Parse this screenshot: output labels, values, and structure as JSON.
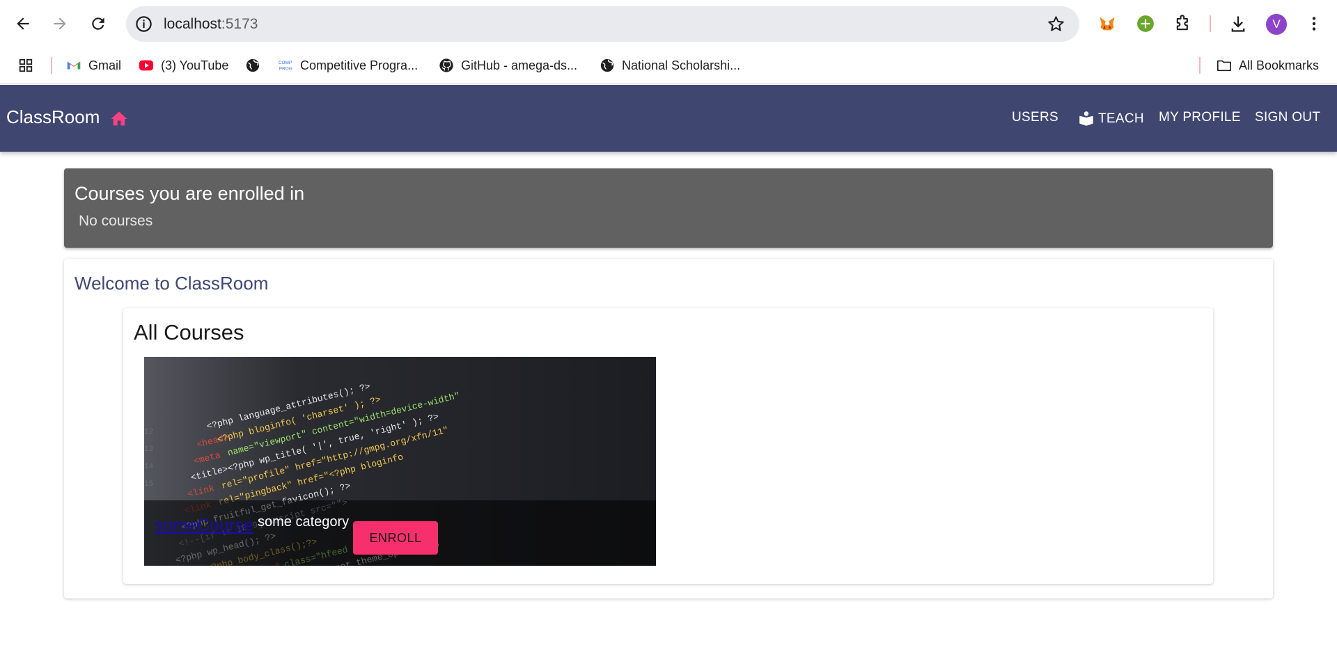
{
  "browser": {
    "url_host": "localhost",
    "url_port": ":5173",
    "avatar_letter": "V",
    "bookmarks": [
      {
        "label": "Gmail"
      },
      {
        "label": "(3) YouTube"
      },
      {
        "label": ""
      },
      {
        "label": "Competitive Progra..."
      },
      {
        "label": "GitHub - amega-ds..."
      },
      {
        "label": "National Scholarshi..."
      }
    ],
    "all_bookmarks_label": "All Bookmarks"
  },
  "appbar": {
    "brand": "ClassRoom",
    "links": {
      "users": "USERS",
      "teach": "TEACH",
      "profile": "MY PROFILE",
      "signout": "SIGN OUT"
    },
    "colors": {
      "bar": "#3f4771",
      "home_icon": "#ff4081"
    }
  },
  "enrolled": {
    "title": "Courses you are enrolled in",
    "empty_text": "No courses"
  },
  "welcome": {
    "title": "Welcome to ClassRoom",
    "all_courses_title": "All Courses",
    "courses": [
      {
        "name": "someCourse",
        "category": "some category",
        "button_label": "ENROLL"
      }
    ]
  }
}
